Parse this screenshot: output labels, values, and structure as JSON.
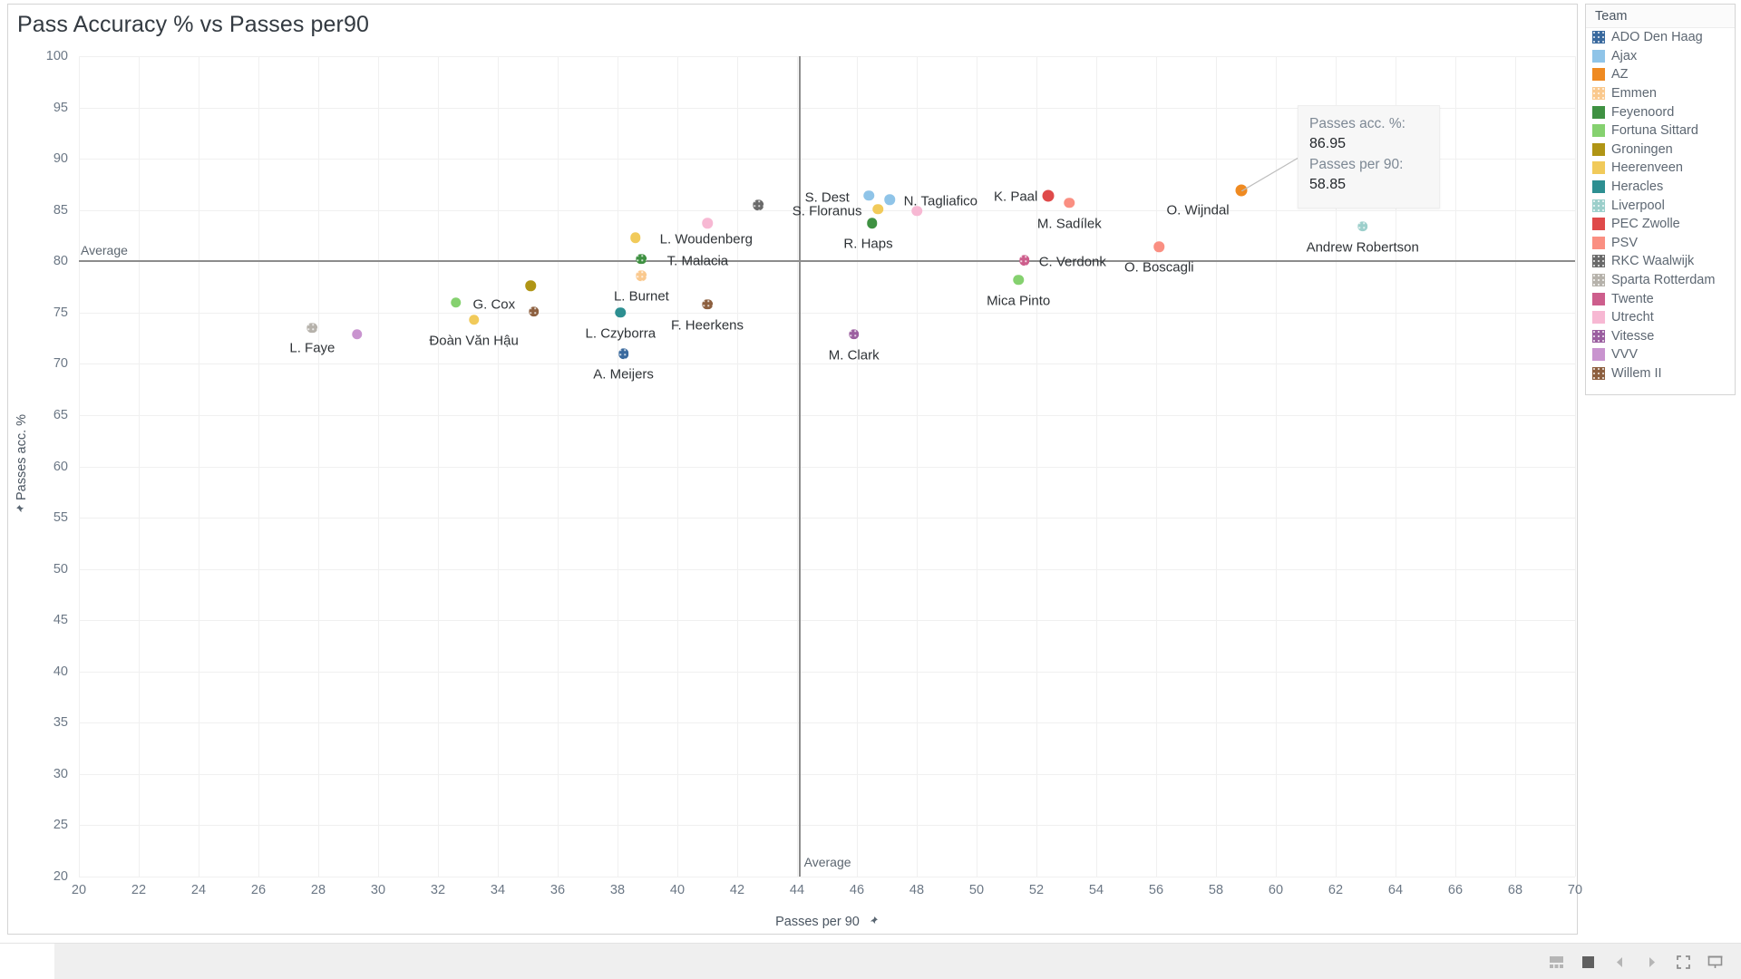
{
  "header": {
    "title": "Pass Accuracy % vs Passes per90"
  },
  "axes": {
    "x": {
      "title": "Passes per 90",
      "pin_icon": "pin-icon",
      "ticks": [
        20,
        22,
        24,
        26,
        28,
        30,
        32,
        34,
        36,
        38,
        40,
        42,
        44,
        46,
        48,
        50,
        52,
        54,
        56,
        58,
        60,
        62,
        64,
        66,
        68,
        70
      ],
      "min": 20,
      "max": 70
    },
    "y": {
      "title": "Passes acc. %",
      "pin_icon": "pin-icon",
      "ticks": [
        20,
        25,
        30,
        35,
        40,
        45,
        50,
        55,
        60,
        65,
        70,
        75,
        80,
        85,
        90,
        95,
        100
      ],
      "min": 20,
      "max": 100
    }
  },
  "reference_lines": {
    "horizontal": {
      "label": "Average",
      "value": 80.1
    },
    "vertical": {
      "label": "Average",
      "value": 44.05
    }
  },
  "tooltip": {
    "rows": [
      {
        "label": "Passes acc. %:",
        "value": "86.95"
      },
      {
        "label": "Passes per 90:",
        "value": "58.85"
      }
    ]
  },
  "legend": {
    "title": "Team",
    "items": [
      {
        "label": "ADO Den Haag",
        "color": "#3a6a9e",
        "pattern": "dots"
      },
      {
        "label": "Ajax",
        "color": "#8fc4e8",
        "pattern": "solid"
      },
      {
        "label": "AZ",
        "color": "#ef8a21",
        "pattern": "solid"
      },
      {
        "label": "Emmen",
        "color": "#fac98e",
        "pattern": "dots"
      },
      {
        "label": "Feyenoord",
        "color": "#3f9142",
        "pattern": "solid"
      },
      {
        "label": "Fortuna Sittard",
        "color": "#85d16f",
        "pattern": "solid"
      },
      {
        "label": "Groningen",
        "color": "#b09515",
        "pattern": "solid"
      },
      {
        "label": "Heerenveen",
        "color": "#f1ca5a",
        "pattern": "solid"
      },
      {
        "label": "Heracles",
        "color": "#2d8f91",
        "pattern": "solid"
      },
      {
        "label": "Liverpool",
        "color": "#9ccfcb",
        "pattern": "dots"
      },
      {
        "label": "PEC Zwolle",
        "color": "#df4a4a",
        "pattern": "solid"
      },
      {
        "label": "PSV",
        "color": "#fa8f82",
        "pattern": "solid"
      },
      {
        "label": "RKC Waalwijk",
        "color": "#6a6a6a",
        "pattern": "dots"
      },
      {
        "label": "Sparta Rotterdam",
        "color": "#b6b2ab",
        "pattern": "dots"
      },
      {
        "label": "Twente",
        "color": "#cd5e8c",
        "pattern": "solid"
      },
      {
        "label": "Utrecht",
        "color": "#f7b8d3",
        "pattern": "solid"
      },
      {
        "label": "Vitesse",
        "color": "#9b5fa0",
        "pattern": "dots"
      },
      {
        "label": "VVV",
        "color": "#c994cf",
        "pattern": "solid"
      },
      {
        "label": "Willem II",
        "color": "#8d6040",
        "pattern": "dots"
      }
    ]
  },
  "statusbar": {
    "icons": [
      "dashboard-icon",
      "worksheet-icon",
      "previous-icon",
      "next-icon",
      "fullscreen-icon",
      "presentation-icon"
    ]
  },
  "chart_data": {
    "type": "scatter",
    "title": "Pass Accuracy % vs Passes per90",
    "xlabel": "Passes per 90",
    "ylabel": "Passes acc. %",
    "xlim": [
      20,
      70
    ],
    "ylim": [
      20,
      100
    ],
    "grid": true,
    "legend_position": "right",
    "color_field": "Team",
    "reference_lines": [
      {
        "orientation": "horizontal",
        "label": "Average",
        "value": 80.1
      },
      {
        "orientation": "vertical",
        "label": "Average",
        "value": 44.05
      }
    ],
    "points": [
      {
        "name": "L. Faye",
        "team": "Sparta Rotterdam",
        "x": 27.8,
        "y": 73.5,
        "color": "#b6b2ab",
        "pattern": "dots",
        "label_dx": 0,
        "label_dy": 22
      },
      {
        "name": "",
        "team": "VVV",
        "x": 29.3,
        "y": 72.9,
        "color": "#c994cf",
        "pattern": "solid",
        "label_dx": 0,
        "label_dy": 0
      },
      {
        "name": "G. Cox",
        "team": "Fortuna Sittard",
        "x": 32.6,
        "y": 76.0,
        "color": "#85d16f",
        "pattern": "solid",
        "label_dx": 42,
        "label_dy": 2
      },
      {
        "name": "Đoàn Văn Hậu",
        "team": "Heerenveen",
        "x": 33.2,
        "y": 74.3,
        "color": "#f1ca5a",
        "pattern": "solid",
        "label_dx": 0,
        "label_dy": 23
      },
      {
        "name": "",
        "team": "Groningen",
        "x": 35.1,
        "y": 77.6,
        "color": "#b09515",
        "pattern": "solid",
        "label_dx": 0,
        "label_dy": 0
      },
      {
        "name": "",
        "team": "Willem II",
        "x": 35.2,
        "y": 75.1,
        "color": "#8d6040",
        "pattern": "dots",
        "label_dx": 0,
        "label_dy": 0
      },
      {
        "name": "L. Czyborra",
        "team": "Heracles",
        "x": 38.1,
        "y": 75.0,
        "color": "#2d8f91",
        "pattern": "solid",
        "label_dx": 0,
        "label_dy": 23
      },
      {
        "name": "A. Meijers",
        "team": "ADO Den Haag",
        "x": 38.2,
        "y": 71.0,
        "color": "#3a6a9e",
        "pattern": "dots",
        "label_dx": 0,
        "label_dy": 23
      },
      {
        "name": "L. Woudenberg",
        "team": "Heerenveen",
        "x": 38.6,
        "y": 82.3,
        "color": "#f1ca5a",
        "pattern": "solid",
        "label_dx": 78,
        "label_dy": 2
      },
      {
        "name": "T. Malacia",
        "team": "Feyenoord",
        "x": 38.8,
        "y": 80.2,
        "color": "#3f9142",
        "pattern": "dots",
        "label_dx": 62,
        "label_dy": 2
      },
      {
        "name": "L. Burnet",
        "team": "Emmen",
        "x": 38.8,
        "y": 78.6,
        "color": "#fac98e",
        "pattern": "dots",
        "label_dx": 0,
        "label_dy": 23
      },
      {
        "name": "F. Heerkens",
        "team": "Willem II",
        "x": 41.0,
        "y": 75.8,
        "color": "#8d6040",
        "pattern": "dots",
        "label_dx": 0,
        "label_dy": 23
      },
      {
        "name": "",
        "team": "Utrecht",
        "x": 41.0,
        "y": 83.7,
        "color": "#f7b8d3",
        "pattern": "solid",
        "label_dx": 0,
        "label_dy": 0
      },
      {
        "name": "",
        "team": "RKC Waalwijk",
        "x": 42.7,
        "y": 85.5,
        "color": "#6a6a6a",
        "pattern": "dots",
        "label_dx": 0,
        "label_dy": 0
      },
      {
        "name": "M. Clark",
        "team": "Vitesse",
        "x": 45.9,
        "y": 72.9,
        "color": "#9b5fa0",
        "pattern": "dots",
        "label_dx": 0,
        "label_dy": 23
      },
      {
        "name": "S. Dest",
        "team": "Ajax",
        "x": 46.4,
        "y": 86.4,
        "color": "#8fc4e8",
        "pattern": "solid",
        "label_dx": -46,
        "label_dy": 2
      },
      {
        "name": "S. Floranus",
        "team": "Heerenveen",
        "x": 46.7,
        "y": 85.1,
        "color": "#f1ca5a",
        "pattern": "solid",
        "label_dx": -56,
        "label_dy": 2
      },
      {
        "name": "R. Haps",
        "team": "Feyenoord",
        "x": 46.5,
        "y": 83.7,
        "color": "#3f9142",
        "pattern": "solid",
        "label_dx": -4,
        "label_dy": 23
      },
      {
        "name": "N. Tagliafico",
        "team": "Ajax",
        "x": 47.1,
        "y": 86.0,
        "color": "#8fc4e8",
        "pattern": "solid",
        "label_dx": 56,
        "label_dy": 2
      },
      {
        "name": "",
        "team": "Utrecht",
        "x": 48.0,
        "y": 84.9,
        "color": "#f7b8d3",
        "pattern": "solid",
        "label_dx": 0,
        "label_dy": 0
      },
      {
        "name": "Mica Pinto",
        "team": "Fortuna Sittard",
        "x": 51.4,
        "y": 78.2,
        "color": "#85d16f",
        "pattern": "solid",
        "label_dx": 0,
        "label_dy": 23
      },
      {
        "name": "C. Verdonk",
        "team": "Twente",
        "x": 51.6,
        "y": 80.1,
        "color": "#cd5e8c",
        "pattern": "dots",
        "label_dx": 53,
        "label_dy": 2
      },
      {
        "name": "K. Paal",
        "team": "PEC Zwolle",
        "x": 52.4,
        "y": 86.4,
        "color": "#df4a4a",
        "pattern": "solid",
        "label_dx": -36,
        "label_dy": 1
      },
      {
        "name": "M. Sadílek",
        "team": "PSV",
        "x": 53.1,
        "y": 85.7,
        "color": "#fa8f82",
        "pattern": "solid",
        "label_dx": 0,
        "label_dy": 23
      },
      {
        "name": "O. Boscagli",
        "team": "PSV",
        "x": 56.1,
        "y": 81.4,
        "color": "#fa8f82",
        "pattern": "solid",
        "label_dx": 0,
        "label_dy": 23
      },
      {
        "name": "O. Wijndal",
        "team": "AZ",
        "x": 58.85,
        "y": 86.95,
        "color": "#ef8a21",
        "pattern": "solid",
        "label_dx": -48,
        "label_dy": 22
      },
      {
        "name": "Andrew Robertson",
        "team": "Liverpool",
        "x": 62.9,
        "y": 83.4,
        "color": "#9ccfcb",
        "pattern": "dots",
        "label_dx": 0,
        "label_dy": 23
      }
    ]
  }
}
